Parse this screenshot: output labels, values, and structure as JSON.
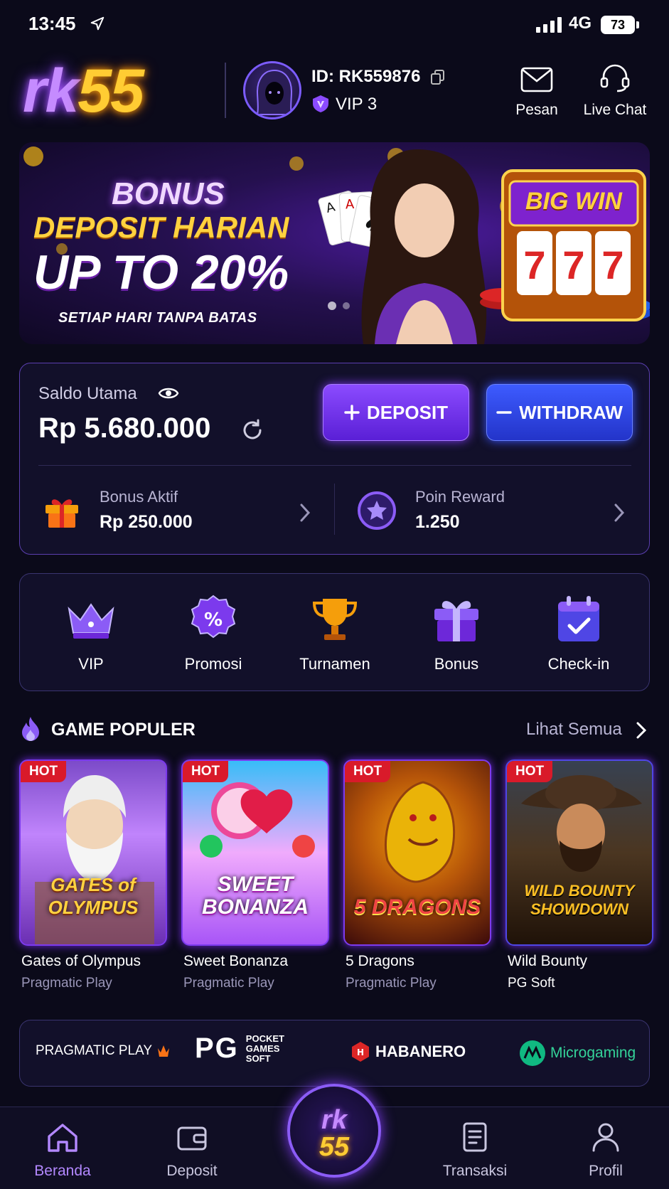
{
  "status_bar": {
    "time": "13:45",
    "network": "4G",
    "battery": "73"
  },
  "header": {
    "logo_rk": "rk",
    "logo_num": "55",
    "user_id": "ID: RK559876",
    "vip_level": "VIP 3",
    "messages_label": "Pesan",
    "live_chat_label": "Live Chat"
  },
  "banner": {
    "line1": "BONUS",
    "line2": "DEPOSIT HARIAN",
    "line3": "UP TO 20%",
    "line4": "SETIAP HARI TANPA BATAS",
    "badge": "BIG WIN",
    "reels": [
      "7",
      "7",
      "7"
    ]
  },
  "wallet": {
    "label": "Saldo Utama",
    "balance": "Rp 5.680.000",
    "deposit_label": "DEPOSIT",
    "withdraw_label": "WITHDRAW",
    "bonus_label": "Bonus Aktif",
    "bonus_value": "Rp 250.000",
    "points_label": "Poin Reward",
    "points_value": "1.250"
  },
  "quick_menu": [
    {
      "label": "VIP",
      "icon": "crown-icon"
    },
    {
      "label": "Promosi",
      "icon": "percent-badge-icon"
    },
    {
      "label": "Turnamen",
      "icon": "trophy-icon"
    },
    {
      "label": "Bonus",
      "icon": "gift-icon"
    },
    {
      "label": "Check-in",
      "icon": "calendar-check-icon"
    }
  ],
  "popular": {
    "title": "GAME POPULER",
    "see_all": "Lihat Semua",
    "hot_label": "HOT",
    "games": [
      {
        "art_title": "GATES of OLYMPUS",
        "name": "Gates of Olympus",
        "provider": "Pragmatic Play"
      },
      {
        "art_title": "SWEET BONANZA",
        "name": "Sweet Bonanza",
        "provider": "Pragmatic Play"
      },
      {
        "art_title": "5 DRAGONS",
        "name": "5 Dragons",
        "provider": "Pragmatic Play"
      },
      {
        "art_title": "WILD BOUNTY SHOWDOWN",
        "name": "Wild Bounty",
        "provider": "PG Soft"
      }
    ]
  },
  "providers": {
    "pragmatic": "PRAGMATIC PLAY",
    "pg_big": "PG",
    "pg_small": "POCKET GAMES SOFT",
    "habanero": "HABANERO",
    "microgaming": "Microgaming"
  },
  "bottom_nav": {
    "home": "Beranda",
    "deposit": "Deposit",
    "center_rk": "rk",
    "center_num": "55",
    "transactions": "Transaksi",
    "profile": "Profil"
  },
  "colors": {
    "accent_purple": "#8b4bff",
    "accent_blue": "#3d5bff",
    "gold": "#ffcc33",
    "hot_red": "#d91a2a",
    "background": "#0b0a1a"
  }
}
